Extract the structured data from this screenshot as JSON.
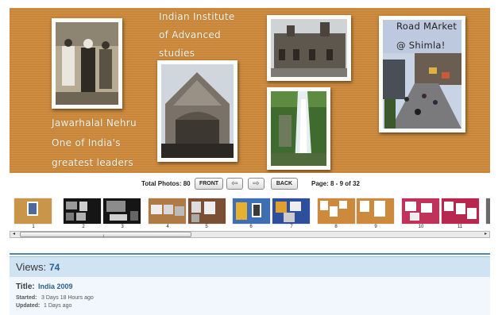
{
  "spread": {
    "captions": {
      "institute_line1": "Indian Institute",
      "institute_line2": "of Advanced",
      "institute_line3": "studies",
      "nehru_line1": "Jawarhalal Nehru",
      "nehru_line2": "One of India's",
      "nehru_line3": "greatest leaders",
      "market_line1": "Road MArket",
      "market_line2": "@ Shimla!"
    }
  },
  "nav": {
    "total_photos": "Total Photos: 80",
    "front_label": "FRONT",
    "back_label": "BACK",
    "prev_icon": "left-arrow-icon",
    "next_icon": "right-arrow-icon",
    "page_info": "Page: 8 - 9 of 32"
  },
  "thumbnails": {
    "numbers": [
      "1",
      "2",
      "3",
      "4",
      "5",
      "6",
      "7",
      "8",
      "9",
      "10",
      "11"
    ]
  },
  "scrollbar": {
    "left_arrow": "◂",
    "right_arrow": "▸",
    "grip": "|||"
  },
  "info": {
    "views_label": "Views:",
    "views_value": "74",
    "title_label": "Title:",
    "title_value": "India 2009",
    "started_label": "Started:",
    "started_value": "3 Days 18 Hours ago",
    "updated_label": "Updated:",
    "updated_value": "1 Days ago"
  },
  "colors": {
    "spread_background": "#cd8a3c",
    "views_bar": "#cfe3f3",
    "accent_blue": "#2e5f8f"
  }
}
